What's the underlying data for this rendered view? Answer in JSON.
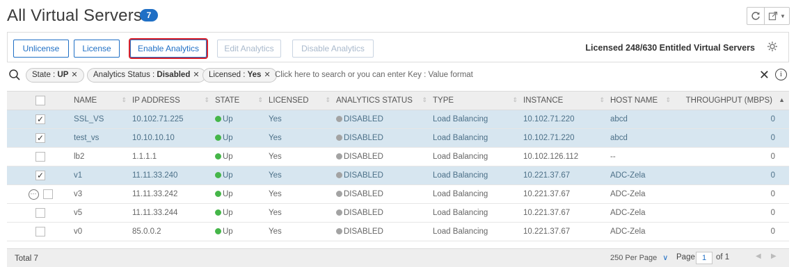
{
  "page": {
    "title": "All Virtual Servers",
    "count_badge": "7"
  },
  "header_icons": {
    "refresh": "refresh-icon",
    "export": "export-icon"
  },
  "toolbar": {
    "unlicense": "Unlicense",
    "license": "License",
    "enable_analytics": "Enable Analytics",
    "edit_analytics": "Edit Analytics",
    "disable_analytics": "Disable Analytics",
    "licensed_text": "Licensed 248/630 Entitled Virtual Servers"
  },
  "search": {
    "chips": [
      {
        "key": "State : ",
        "value": "UP"
      },
      {
        "key": "Analytics Status : ",
        "value": "Disabled"
      },
      {
        "key": "Licensed : ",
        "value": "Yes"
      }
    ],
    "placeholder": "Click here to search or you can enter Key : Value format"
  },
  "table": {
    "columns": [
      "NAME",
      "IP ADDRESS",
      "STATE",
      "LICENSED",
      "ANALYTICS STATUS",
      "TYPE",
      "INSTANCE",
      "HOST NAME",
      "THROUGHPUT (MBPS)"
    ],
    "rows": [
      {
        "selected": true,
        "name": "SSL_VS",
        "ip": "10.102.71.225",
        "state": "Up",
        "licensed": "Yes",
        "analytics": "DISABLED",
        "type": "Load Balancing",
        "instance": "10.102.71.220",
        "host": "abcd",
        "throughput": "0"
      },
      {
        "selected": true,
        "name": "test_vs",
        "ip": "10.10.10.10",
        "state": "Up",
        "licensed": "Yes",
        "analytics": "DISABLED",
        "type": "Load Balancing",
        "instance": "10.102.71.220",
        "host": "abcd",
        "throughput": "0"
      },
      {
        "selected": false,
        "name": "lb2",
        "ip": "1.1.1.1",
        "state": "Up",
        "licensed": "Yes",
        "analytics": "DISABLED",
        "type": "Load Balancing",
        "instance": "10.102.126.112",
        "host": "--",
        "throughput": "0"
      },
      {
        "selected": true,
        "name": "v1",
        "ip": "11.11.33.240",
        "state": "Up",
        "licensed": "Yes",
        "analytics": "DISABLED",
        "type": "Load Balancing",
        "instance": "10.221.37.67",
        "host": "ADC-Zela",
        "throughput": "0"
      },
      {
        "selected": false,
        "name": "v3",
        "ip": "11.11.33.242",
        "state": "Up",
        "licensed": "Yes",
        "analytics": "DISABLED",
        "type": "Load Balancing",
        "instance": "10.221.37.67",
        "host": "ADC-Zela",
        "throughput": "0"
      },
      {
        "selected": false,
        "name": "v5",
        "ip": "11.11.33.244",
        "state": "Up",
        "licensed": "Yes",
        "analytics": "DISABLED",
        "type": "Load Balancing",
        "instance": "10.221.37.67",
        "host": "ADC-Zela",
        "throughput": "0"
      },
      {
        "selected": false,
        "name": "v0",
        "ip": "85.0.0.2",
        "state": "Up",
        "licensed": "Yes",
        "analytics": "DISABLED",
        "type": "Load Balancing",
        "instance": "10.221.37.67",
        "host": "ADC-Zela",
        "throughput": "0"
      }
    ]
  },
  "footer": {
    "total": "Total 7",
    "per_page": "250 Per Page",
    "page_label": "Page",
    "page_value": "1",
    "of_label": "of 1"
  },
  "colors": {
    "accent": "#1f6fc5",
    "selected_row": "#d7e6f0",
    "highlight_border": "#d9232d",
    "status_up": "#45b649"
  }
}
